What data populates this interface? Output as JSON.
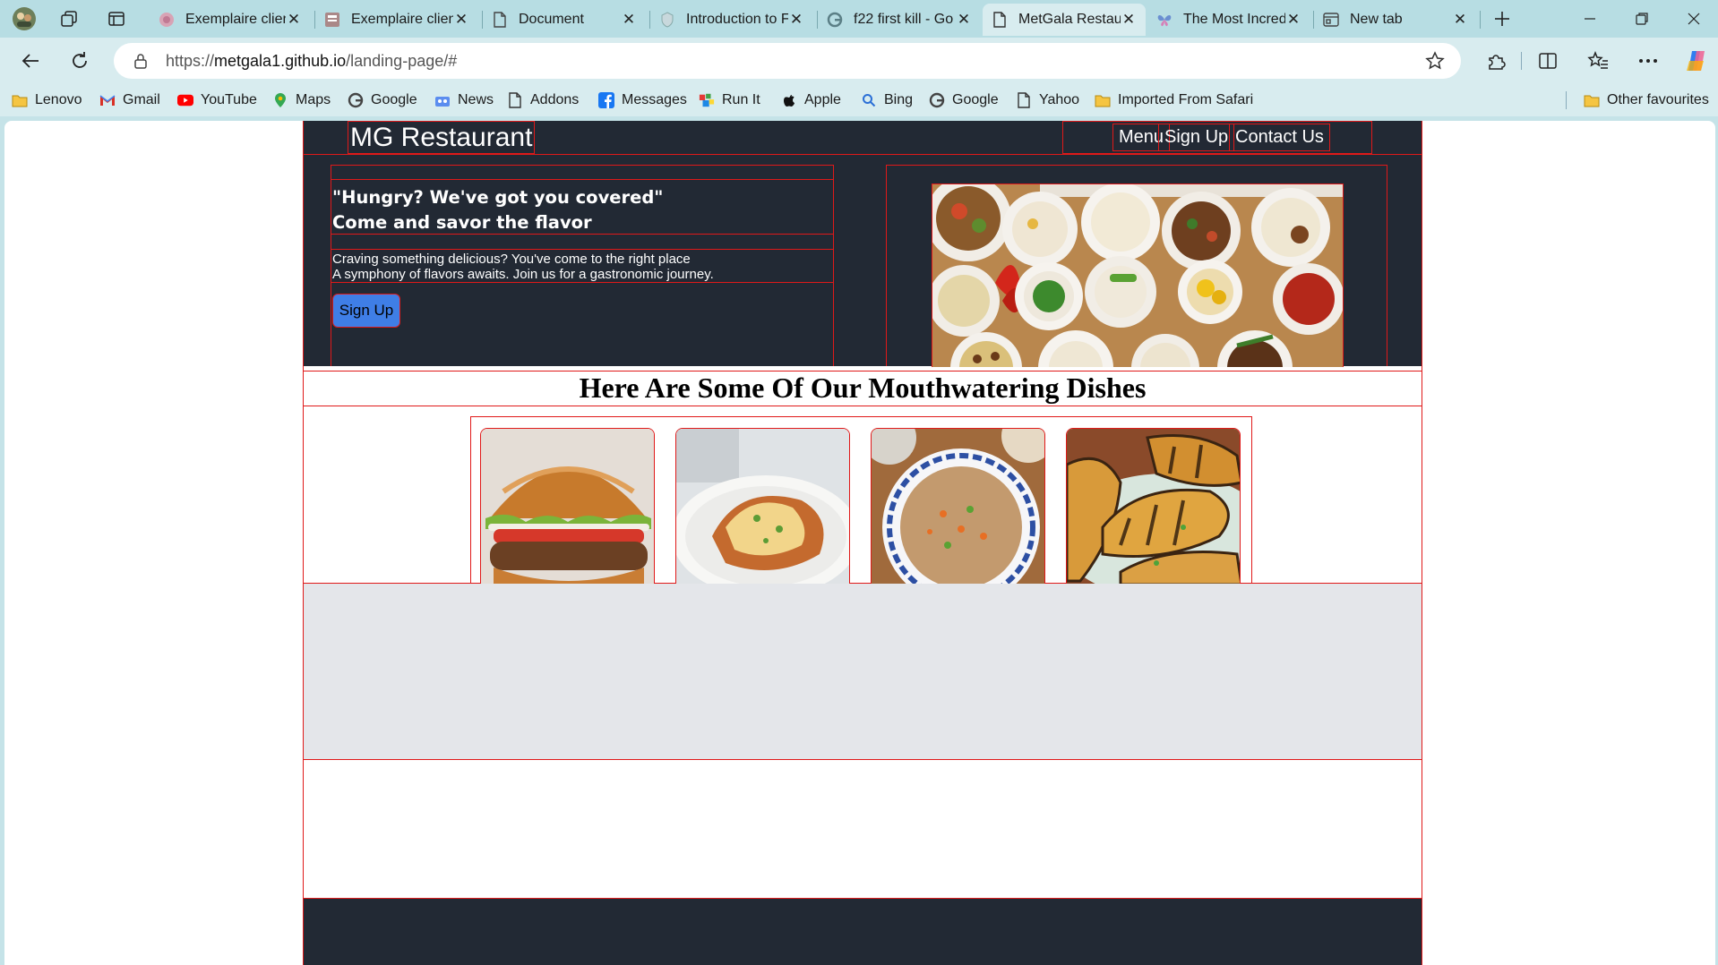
{
  "browser": {
    "tabs": [
      {
        "title": "Exemplaire client",
        "icon": "pink-circle-icon"
      },
      {
        "title": "Exemplaire client",
        "icon": "document-thumbnail-icon"
      },
      {
        "title": "Document",
        "icon": "page-icon"
      },
      {
        "title": "Introduction to F",
        "icon": "shield-icon"
      },
      {
        "title": "f22 first kill - Go",
        "icon": "google-icon"
      },
      {
        "title": "MetGala Restaura",
        "icon": "page-icon",
        "active": true
      },
      {
        "title": "The Most Incredi",
        "icon": "butterfly-icon"
      },
      {
        "title": "New tab",
        "icon": "new-tab-icon"
      }
    ],
    "url": {
      "prefix": "https://",
      "host": "metgala1.github.io",
      "path": "/landing-page/#"
    },
    "bookmarks": [
      {
        "label": "Lenovo",
        "icon": "folder-icon"
      },
      {
        "label": "Gmail",
        "icon": "gmail-icon"
      },
      {
        "label": "YouTube",
        "icon": "youtube-icon"
      },
      {
        "label": "Maps",
        "icon": "maps-pin-icon"
      },
      {
        "label": "Google",
        "icon": "google-icon"
      },
      {
        "label": "News",
        "icon": "news-icon"
      },
      {
        "label": "Addons",
        "icon": "page-icon"
      },
      {
        "label": "Messages",
        "icon": "facebook-icon"
      },
      {
        "label": "Run It",
        "icon": "game-icon"
      },
      {
        "label": "Apple",
        "icon": "apple-icon"
      },
      {
        "label": "Bing",
        "icon": "search-icon"
      },
      {
        "label": "Google",
        "icon": "google-icon"
      },
      {
        "label": "Yahoo",
        "icon": "page-icon"
      },
      {
        "label": "Imported From Safari",
        "icon": "folder-icon"
      }
    ],
    "other_favourites": "Other favourites"
  },
  "site": {
    "brand": "MG Restaurant",
    "nav": [
      "Menu",
      "Sign Up",
      "Contact Us"
    ],
    "hero": {
      "headline_1": "\"Hungry? We've got you covered\"",
      "headline_2": "Come and savor the flavor",
      "text_1": "Craving something delicious? You've come to the right place",
      "text_2": "A symphony of flavors awaits. Join us for a gastronomic journey.",
      "button": "Sign Up"
    },
    "dishes_title": "Here Are Some Of Our Mouthwatering Dishes",
    "dishes": [
      "burger",
      "lasagna",
      "fried rice",
      "grilled sweet potatoes"
    ]
  },
  "colors": {
    "header_bg": "#222934",
    "accent_border": "#e01919",
    "button_bg": "#3f7ee6",
    "grey_band": "#e4e6ea",
    "browser_frame": "#b7dde3"
  }
}
